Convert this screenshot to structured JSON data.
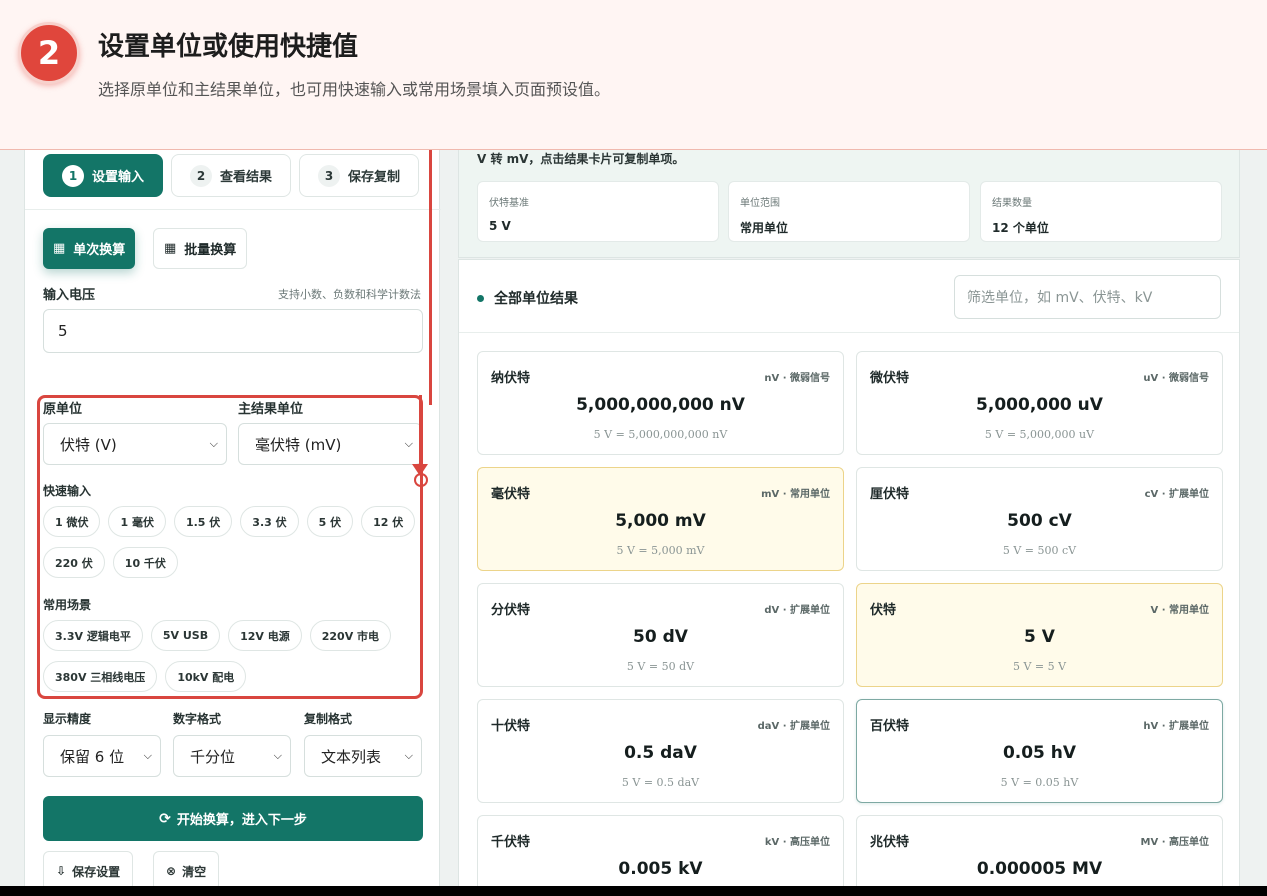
{
  "tutorial": {
    "step_number": "2",
    "title": "设置单位或使用快捷值",
    "description": "选择原单位和主结果单位，也可用快速输入或常用场景填入页面预设值。"
  },
  "steps": [
    {
      "num": "1",
      "label": "设置输入"
    },
    {
      "num": "2",
      "label": "查看结果"
    },
    {
      "num": "3",
      "label": "保存复制"
    }
  ],
  "modes": {
    "single": "单次换算",
    "batch": "批量换算"
  },
  "voltage_input": {
    "label": "输入电压",
    "hint": "支持小数、负数和科学计数法",
    "value": "5"
  },
  "source_unit": {
    "label": "原单位",
    "value": "伏特 (V)"
  },
  "target_unit": {
    "label": "主结果单位",
    "value": "毫伏特 (mV)"
  },
  "quick_input": {
    "label": "快速输入",
    "chips": [
      "1 微伏",
      "1 毫伏",
      "1.5 伏",
      "3.3 伏",
      "5 伏",
      "12 伏",
      "220 伏",
      "10 千伏"
    ]
  },
  "scenes": {
    "label": "常用场景",
    "chips": [
      "3.3V 逻辑电平",
      "5V USB",
      "12V 电源",
      "220V 市电",
      "380V 三相线电压",
      "10kV 配电"
    ]
  },
  "precision": {
    "label": "显示精度",
    "value": "保留 6 位"
  },
  "number_format": {
    "label": "数字格式",
    "value": "千分位"
  },
  "copy_format": {
    "label": "复制格式",
    "value": "文本列表"
  },
  "actions": {
    "run": "开始换算，进入下一步",
    "save": "保存设置",
    "clear": "清空"
  },
  "summary": {
    "note": "V 转 mV，点击结果卡片可复制单项。",
    "stats": [
      {
        "key": "伏特基准",
        "value": "5 V"
      },
      {
        "key": "单位范围",
        "value": "常用单位"
      },
      {
        "key": "结果数量",
        "value": "12 个单位"
      }
    ]
  },
  "results": {
    "title": "全部单位结果",
    "filter_placeholder": "筛选单位，如 mV、伏特、kV",
    "cards": [
      {
        "name": "纳伏特",
        "tag": "nV · 微弱信号",
        "value": "5,000,000,000 nV",
        "eq": "5 V = 5,000,000,000 nV"
      },
      {
        "name": "微伏特",
        "tag": "uV · 微弱信号",
        "value": "5,000,000 uV",
        "eq": "5 V = 5,000,000 uV"
      },
      {
        "name": "毫伏特",
        "tag": "mV · 常用单位",
        "value": "5,000 mV",
        "eq": "5 V = 5,000 mV"
      },
      {
        "name": "厘伏特",
        "tag": "cV · 扩展单位",
        "value": "500 cV",
        "eq": "5 V = 500 cV"
      },
      {
        "name": "分伏特",
        "tag": "dV · 扩展单位",
        "value": "50 dV",
        "eq": "5 V = 50 dV"
      },
      {
        "name": "伏特",
        "tag": "V · 常用单位",
        "value": "5 V",
        "eq": "5 V = 5 V"
      },
      {
        "name": "十伏特",
        "tag": "daV · 扩展单位",
        "value": "0.5 daV",
        "eq": "5 V = 0.5 daV"
      },
      {
        "name": "百伏特",
        "tag": "hV · 扩展单位",
        "value": "0.05 hV",
        "eq": "5 V = 0.05 hV"
      },
      {
        "name": "千伏特",
        "tag": "kV · 高压单位",
        "value": "0.005 kV",
        "eq": ""
      },
      {
        "name": "兆伏特",
        "tag": "MV · 高压单位",
        "value": "0.000005 MV",
        "eq": ""
      }
    ]
  }
}
